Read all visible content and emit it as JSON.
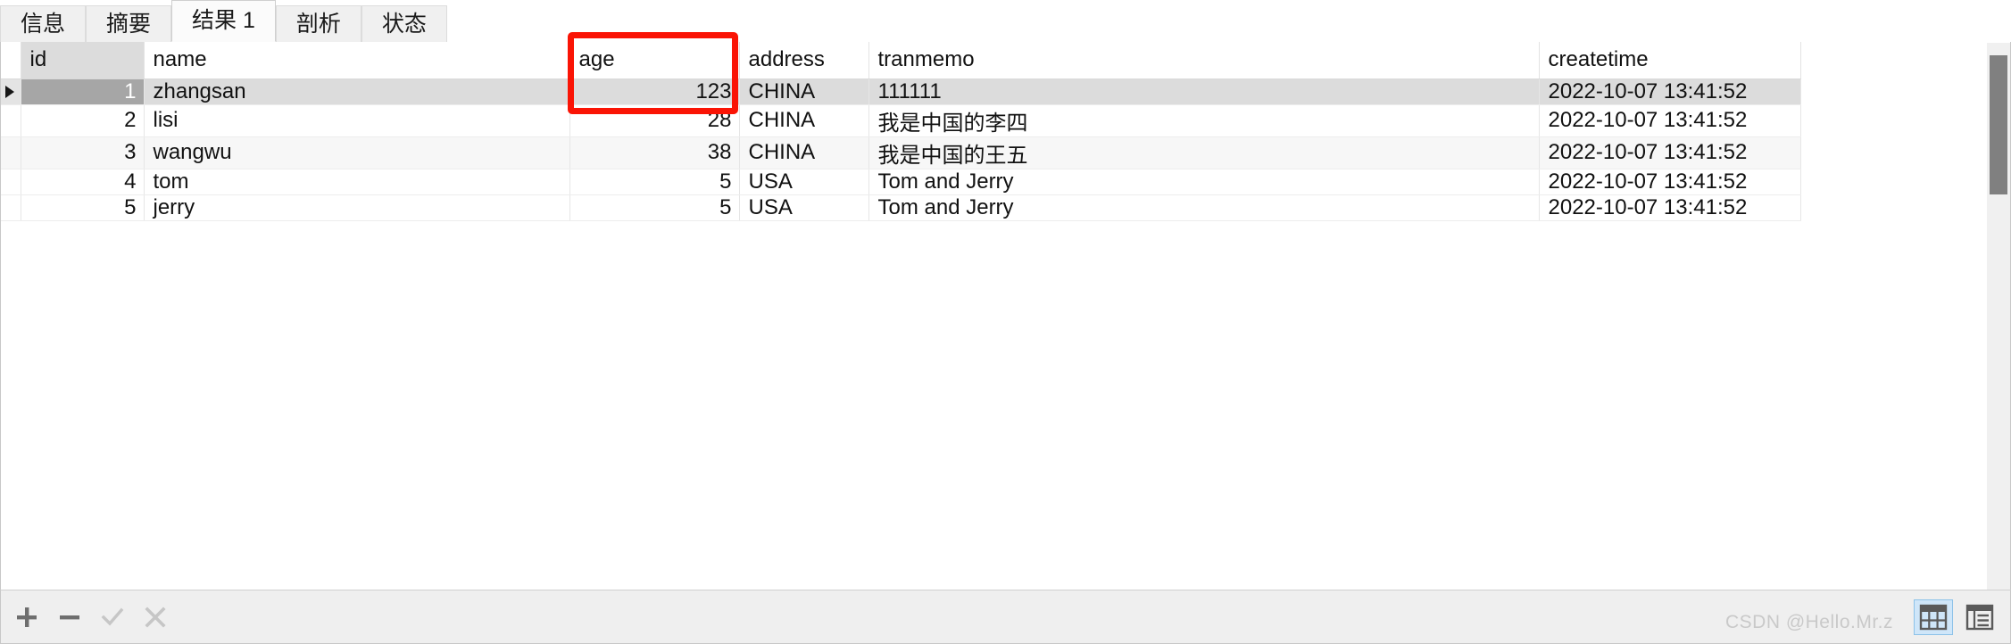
{
  "tabs": [
    {
      "label": "信息",
      "active": false
    },
    {
      "label": "摘要",
      "active": false
    },
    {
      "label": "结果 1",
      "active": true
    },
    {
      "label": "剖析",
      "active": false
    },
    {
      "label": "状态",
      "active": false
    }
  ],
  "grid": {
    "columns": [
      "id",
      "name",
      "age",
      "address",
      "tranmemo",
      "createtime"
    ],
    "selected_column": "id",
    "active_cell": {
      "row": 0,
      "column": "id"
    },
    "rows": [
      {
        "id": "1",
        "name": "zhangsan",
        "age": "123",
        "address": "CHINA",
        "tranmemo": "111111",
        "createtime": "2022-10-07 13:41:52"
      },
      {
        "id": "2",
        "name": "lisi",
        "age": "28",
        "address": "CHINA",
        "tranmemo": "我是中国的李四",
        "createtime": "2022-10-07 13:41:52"
      },
      {
        "id": "3",
        "name": "wangwu",
        "age": "38",
        "address": "CHINA",
        "tranmemo": "我是中国的王五",
        "createtime": "2022-10-07 13:41:52"
      },
      {
        "id": "4",
        "name": "tom",
        "age": "5",
        "address": "USA",
        "tranmemo": "Tom and Jerry",
        "createtime": "2022-10-07 13:41:52"
      },
      {
        "id": "5",
        "name": "jerry",
        "age": "5",
        "address": "USA",
        "tranmemo": "Tom and Jerry",
        "createtime": "2022-10-07 13:41:52"
      }
    ]
  },
  "annotation": {
    "color": "#fa1405",
    "target_column": "age"
  },
  "bottombar": {
    "record_nav": [
      {
        "icon": "plus-icon",
        "label": "+"
      },
      {
        "icon": "minus-icon",
        "label": "−"
      },
      {
        "icon": "check-icon",
        "label": "✓"
      },
      {
        "icon": "cross-icon",
        "label": "✕"
      }
    ],
    "view_modes": [
      {
        "icon": "grid-view-icon",
        "selected": true
      },
      {
        "icon": "form-view-icon",
        "selected": false
      }
    ]
  },
  "watermark": {
    "text": "CSDN @Hello.Mr.z"
  }
}
